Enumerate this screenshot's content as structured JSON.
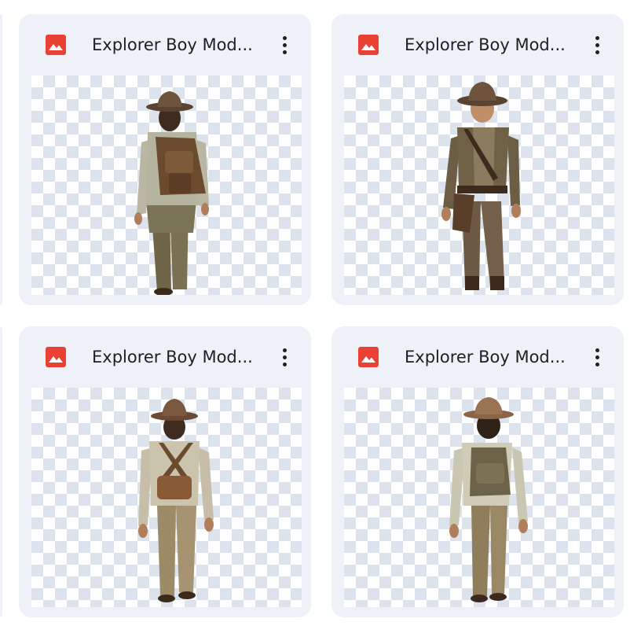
{
  "files": [
    {
      "name": "Explorer Boy Mod...",
      "icon": "image-file-icon",
      "preview": "explorer-boy-back-with-backpack"
    },
    {
      "name": "Explorer Boy Mod...",
      "icon": "image-file-icon",
      "preview": "explorer-boy-front-walking"
    },
    {
      "name": "Explorer Boy Mod...",
      "icon": "image-file-icon",
      "preview": "explorer-boy-back-with-satchel"
    },
    {
      "name": "Explorer Boy Mod...",
      "icon": "image-file-icon",
      "preview": "explorer-boy-back-walking-backpack"
    }
  ],
  "colors": {
    "card_background": "#eef1f7",
    "icon_red": "#e94235",
    "text": "#1f1f1f",
    "checker": "#dde3ec"
  }
}
